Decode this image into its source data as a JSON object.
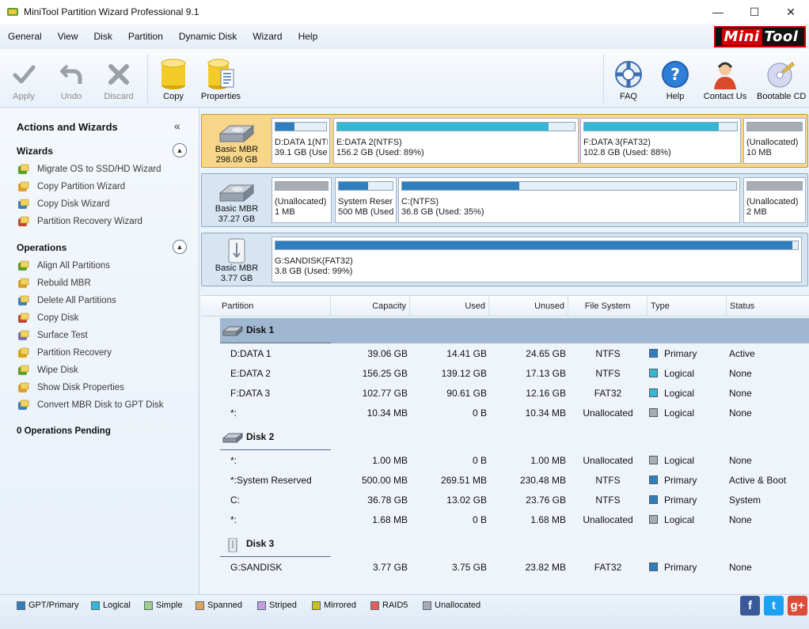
{
  "window": {
    "title": "MiniTool Partition Wizard Professional 9.1",
    "controls": [
      "—",
      "☐",
      "✕"
    ]
  },
  "menu": [
    "General",
    "View",
    "Disk",
    "Partition",
    "Dynamic Disk",
    "Wizard",
    "Help"
  ],
  "logo": {
    "part1": "Mini",
    "part2": "Tool"
  },
  "toolbar": {
    "left": [
      {
        "label": "Apply",
        "icon": "checkmark-icon",
        "enabled": false
      },
      {
        "label": "Undo",
        "icon": "undo-arrow-icon",
        "enabled": false
      },
      {
        "label": "Discard",
        "icon": "x-cross-icon",
        "enabled": false
      },
      {
        "label": "Copy",
        "icon": "copy-cylinder-icon",
        "enabled": true
      },
      {
        "label": "Properties",
        "icon": "properties-cylinder-icon",
        "enabled": true
      }
    ],
    "right": [
      {
        "label": "FAQ",
        "icon": "lifebuoy-icon"
      },
      {
        "label": "Help",
        "icon": "question-icon"
      },
      {
        "label": "Contact Us",
        "icon": "support-person-icon"
      },
      {
        "label": "Bootable CD",
        "icon": "cd-icon"
      }
    ]
  },
  "left_panel": {
    "title": "Actions and Wizards",
    "collapse_glyph": "«",
    "wizards": {
      "heading": "Wizards",
      "items": [
        "Migrate OS to SSD/HD Wizard",
        "Copy Partition Wizard",
        "Copy Disk Wizard",
        "Partition Recovery Wizard"
      ]
    },
    "operations": {
      "heading": "Operations",
      "items": [
        "Align All Partitions",
        "Rebuild MBR",
        "Delete All Partitions",
        "Copy Disk",
        "Surface Test",
        "Partition Recovery",
        "Wipe Disk",
        "Show Disk Properties",
        "Convert MBR Disk to GPT Disk"
      ]
    },
    "pending": "0 Operations Pending"
  },
  "disk_map": [
    {
      "type": "Basic MBR",
      "size": "298.09 GB",
      "selected": true,
      "partitions": [
        {
          "line1": "D:DATA 1(NTF",
          "line2": "39.1 GB (Usec",
          "used": 0.37,
          "color": "#2f7fbf"
        },
        {
          "line1": "E:DATA 2(NTFS)",
          "line2": "156.2 GB (Used: 89%)",
          "used": 0.89,
          "color": "#35b6d3"
        },
        {
          "line1": "F:DATA 3(FAT32)",
          "line2": "102.8 GB (Used: 88%)",
          "used": 0.88,
          "color": "#35b6d3"
        },
        {
          "line1": "(Unallocated)",
          "line2": "10 MB",
          "used": 1.0,
          "color": "#a9adb1"
        }
      ]
    },
    {
      "type": "Basic MBR",
      "size": "37.27 GB",
      "selected": false,
      "partitions": [
        {
          "line1": "(Unallocated)",
          "line2": "1 MB",
          "used": 1.0,
          "color": "#a9adb1"
        },
        {
          "line1": "System Reser",
          "line2": "500 MB (Used:",
          "used": 0.54,
          "color": "#2f7fbf"
        },
        {
          "line1": "C:(NTFS)",
          "line2": "36.8 GB (Used: 35%)",
          "used": 0.35,
          "color": "#2f7fbf"
        },
        {
          "line1": "(Unallocated)",
          "line2": "2 MB",
          "used": 1.0,
          "color": "#a9adb1"
        }
      ]
    },
    {
      "type": "Basic MBR",
      "size": "3.77 GB",
      "selected": false,
      "partitions": [
        {
          "line1": "G:SANDISK(FAT32)",
          "line2": "3.8 GB (Used: 99%)",
          "used": 0.99,
          "color": "#2f7fbf"
        }
      ]
    }
  ],
  "table": {
    "columns": [
      "Partition",
      "Capacity",
      "Used",
      "Unused",
      "File System",
      "Type",
      "Status"
    ],
    "groups": [
      {
        "name": "Disk 1",
        "selected": true,
        "rows": [
          {
            "partition": "D:DATA 1",
            "capacity": "39.06 GB",
            "used": "14.41 GB",
            "unused": "24.65 GB",
            "fs": "NTFS",
            "type": "Primary",
            "type_color": "#2f7fbf",
            "status": "Active"
          },
          {
            "partition": "E:DATA 2",
            "capacity": "156.25 GB",
            "used": "139.12 GB",
            "unused": "17.13 GB",
            "fs": "NTFS",
            "type": "Logical",
            "type_color": "#35b6d3",
            "status": "None"
          },
          {
            "partition": "F:DATA 3",
            "capacity": "102.77 GB",
            "used": "90.61 GB",
            "unused": "12.16 GB",
            "fs": "FAT32",
            "type": "Logical",
            "type_color": "#35b6d3",
            "status": "None"
          },
          {
            "partition": "*:",
            "capacity": "10.34 MB",
            "used": "0 B",
            "unused": "10.34 MB",
            "fs": "Unallocated",
            "type": "Logical",
            "type_color": "#a9adb1",
            "status": "None"
          }
        ]
      },
      {
        "name": "Disk 2",
        "selected": false,
        "rows": [
          {
            "partition": "*:",
            "capacity": "1.00 MB",
            "used": "0 B",
            "unused": "1.00 MB",
            "fs": "Unallocated",
            "type": "Logical",
            "type_color": "#a9adb1",
            "status": "None"
          },
          {
            "partition": "*:System Reserved",
            "capacity": "500.00 MB",
            "used": "269.51 MB",
            "unused": "230.48 MB",
            "fs": "NTFS",
            "type": "Primary",
            "type_color": "#2f7fbf",
            "status": "Active & Boot"
          },
          {
            "partition": "C:",
            "capacity": "36.78 GB",
            "used": "13.02 GB",
            "unused": "23.76 GB",
            "fs": "NTFS",
            "type": "Primary",
            "type_color": "#2f7fbf",
            "status": "System"
          },
          {
            "partition": "*:",
            "capacity": "1.68 MB",
            "used": "0 B",
            "unused": "1.68 MB",
            "fs": "Unallocated",
            "type": "Logical",
            "type_color": "#a9adb1",
            "status": "None"
          }
        ]
      },
      {
        "name": "Disk 3",
        "selected": false,
        "rows": [
          {
            "partition": "G:SANDISK",
            "capacity": "3.77 GB",
            "used": "3.75 GB",
            "unused": "23.82 MB",
            "fs": "FAT32",
            "type": "Primary",
            "type_color": "#2f7fbf",
            "status": "None"
          }
        ]
      }
    ]
  },
  "legend": [
    {
      "label": "GPT/Primary",
      "color": "#2f7fbf"
    },
    {
      "label": "Logical",
      "color": "#35b6d3"
    },
    {
      "label": "Simple",
      "color": "#9fcf84"
    },
    {
      "label": "Spanned",
      "color": "#e0a45c"
    },
    {
      "label": "Striped",
      "color": "#c79be0"
    },
    {
      "label": "Mirrored",
      "color": "#c9c21e"
    },
    {
      "label": "RAID5",
      "color": "#e0605c"
    },
    {
      "label": "Unallocated",
      "color": "#a9adb1"
    }
  ],
  "social": [
    {
      "name": "facebook",
      "glyph": "f",
      "color": "#3b5998"
    },
    {
      "name": "twitter",
      "glyph": "t",
      "color": "#1da1f2"
    },
    {
      "name": "google-plus",
      "glyph": "g+",
      "color": "#dd4b39"
    }
  ]
}
